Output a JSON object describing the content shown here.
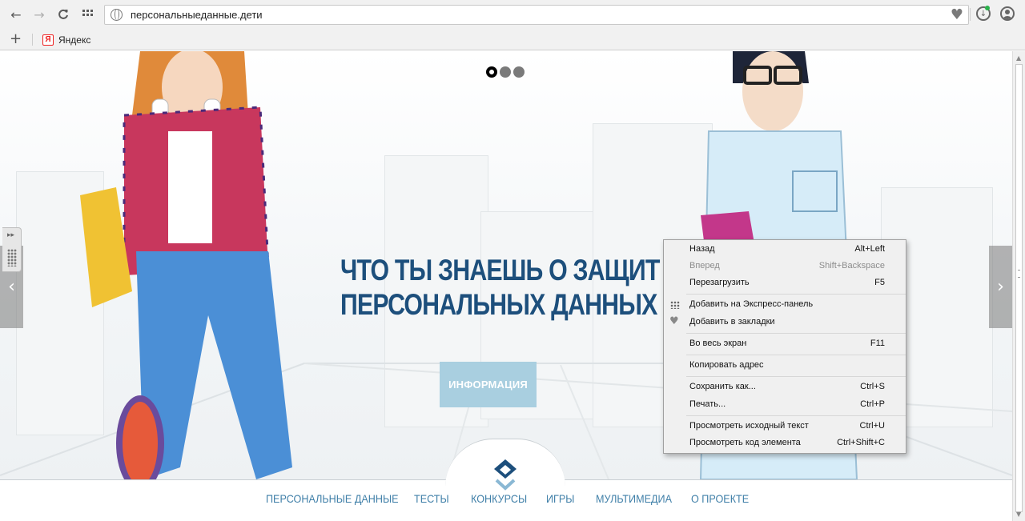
{
  "browser": {
    "nav": {
      "back": "←",
      "forward": "→",
      "reload": "C",
      "speed_dial": "⋮⋮"
    },
    "address_bar": {
      "url": "персональныеданные.дети"
    },
    "icons": {
      "bookmark": "heart-icon",
      "downloads": "download-icon",
      "account": "account-icon"
    },
    "bookmarks_bar": {
      "add_label": "+",
      "items": [
        {
          "icon_letter": "Я",
          "label": "Яндекс",
          "icon_color": "#e22222"
        }
      ]
    }
  },
  "page": {
    "hero": {
      "title_lines": [
        "ЧТО ТЫ ЗНАЕШЬ О ЗАЩИТ",
        "ПЕРСОНАЛЬНЫХ ДАННЫХ"
      ],
      "button_label": "ИНФОРМАЦИЯ",
      "slider_total": 3,
      "slider_active": 1,
      "prev_arrow": "‹",
      "next_arrow": "›",
      "title_color": "#1d4f7c",
      "button_color": "#a9cfe0"
    },
    "nav": {
      "items": [
        "ПЕРСОНАЛЬНЫЕ ДАННЫЕ",
        "ТЕСТЫ",
        "КОНКУРСЫ",
        "ИГРЫ",
        "МУЛЬТИМЕДИА",
        "О ПРОЕКТЕ"
      ],
      "color": "#3f7fa8"
    },
    "side_panel": {
      "toggle": "▸▸"
    }
  },
  "context_menu": {
    "items": [
      {
        "label": "Назад",
        "shortcut": "Alt+Left",
        "enabled": true
      },
      {
        "label": "Вперед",
        "shortcut": "Shift+Backspace",
        "enabled": false
      },
      {
        "label": "Перезагрузить",
        "shortcut": "F5",
        "enabled": true
      },
      {
        "label": "Добавить на Экспресс-панель",
        "shortcut": "",
        "enabled": true,
        "icon": "speed-dial-icon"
      },
      {
        "label": "Добавить в закладки",
        "shortcut": "",
        "enabled": true,
        "icon": "heart-icon"
      },
      {
        "label": "Во весь экран",
        "shortcut": "F11",
        "enabled": true
      },
      {
        "label": "Копировать адрес",
        "shortcut": "",
        "enabled": true
      },
      {
        "label": "Сохранить как...",
        "shortcut": "Ctrl+S",
        "enabled": true
      },
      {
        "label": "Печать...",
        "shortcut": "Ctrl+P",
        "enabled": true
      },
      {
        "label": "Просмотреть исходный текст",
        "shortcut": "Ctrl+U",
        "enabled": true
      },
      {
        "label": "Просмотреть код элемента",
        "shortcut": "Ctrl+Shift+C",
        "enabled": true
      }
    ]
  }
}
